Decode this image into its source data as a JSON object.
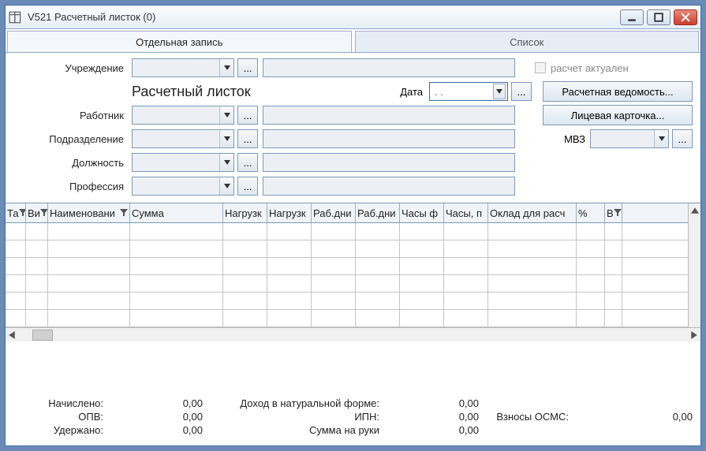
{
  "window": {
    "title": "V521 Расчетный листок (0)"
  },
  "tabs": {
    "single": "Отдельная запись",
    "list": "Список"
  },
  "form": {
    "institution_lbl": "Учреждение",
    "section_title": "Расчетный листок",
    "date_lbl": "Дата",
    "date_val": ".  .",
    "chk_actual": "расчет актуален",
    "btn_vedomost": "Расчетная ведомость...",
    "employee_lbl": "Работник",
    "btn_card": "Лицевая карточка...",
    "dept_lbl": "Подразделение",
    "mvz_lbl": "МВЗ",
    "post_lbl": "Должность",
    "prof_lbl": "Профессия"
  },
  "grid": {
    "columns": [
      {
        "label": "Та",
        "w": 26,
        "filter": true
      },
      {
        "label": "Ви",
        "w": 28,
        "filter": true
      },
      {
        "label": "Наименовани",
        "w": 104,
        "filter": true
      },
      {
        "label": "Сумма",
        "w": 118,
        "filter": false
      },
      {
        "label": "Нагрузк",
        "w": 56,
        "filter": false
      },
      {
        "label": "Нагрузк",
        "w": 56,
        "filter": false
      },
      {
        "label": "Раб.дни",
        "w": 56,
        "filter": false
      },
      {
        "label": "Раб.дни",
        "w": 56,
        "filter": false
      },
      {
        "label": "Часы ф",
        "w": 56,
        "filter": false
      },
      {
        "label": "Часы, п",
        "w": 56,
        "filter": false
      },
      {
        "label": "Оклад для расч",
        "w": 112,
        "filter": false
      },
      {
        "label": "%",
        "w": 36,
        "filter": false
      },
      {
        "label": "В",
        "w": 22,
        "filter": true
      }
    ]
  },
  "summary": {
    "accrued_lbl": "Начислено:",
    "accrued_val": "0,00",
    "opv_lbl": "ОПВ:",
    "opv_val": "0,00",
    "withheld_lbl": "Удержано:",
    "withheld_val": "0,00",
    "natural_lbl": "Доход в натуральной форме:",
    "natural_val": "0,00",
    "ipn_lbl": "ИПН:",
    "ipn_val": "0,00",
    "net_lbl": "Сумма на руки",
    "net_val": "0,00",
    "osms_lbl": "Взносы ОСМС:",
    "osms_val": "0,00"
  }
}
